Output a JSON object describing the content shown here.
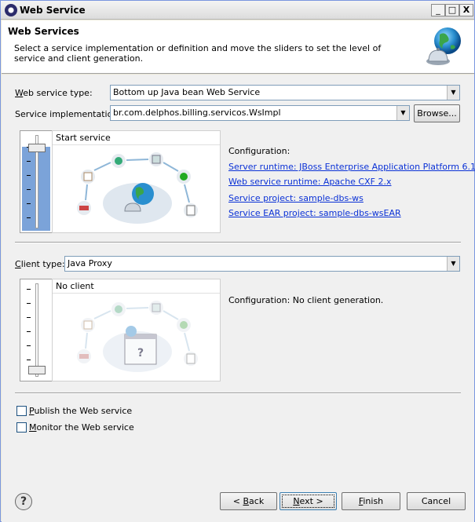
{
  "window": {
    "title": "Web Service",
    "minimize": "_",
    "maximize": "□",
    "close": "X"
  },
  "header": {
    "title": "Web Services",
    "description": "Select a service implementation or definition and move the sliders to set the level of service and client generation."
  },
  "service": {
    "type_label_pre": "",
    "type_label_u": "W",
    "type_label_post": "eb service type:",
    "type_value": "Bottom up Java bean Web Service",
    "impl_label": "Service implementation:",
    "impl_value": "br.com.delphos.billing.servicos.WsImpl",
    "browse": "Browse...",
    "slider_label": "Start service",
    "slider_level": 1,
    "config_heading": "Configuration:",
    "config_links": [
      "Server runtime: JBoss Enterprise Application Platform 6.1+",
      "Web service runtime: Apache CXF 2.x",
      "Service project: sample-dbs-ws",
      "Service EAR project: sample-dbs-wsEAR"
    ]
  },
  "client": {
    "type_label_u": "C",
    "type_label_post": "lient type:",
    "type_value": "Java Proxy",
    "slider_label": "No client",
    "slider_level": 6,
    "config_text": "Configuration: No client generation."
  },
  "options": {
    "publish_label_u": "P",
    "publish_label_post": "ublish the Web service",
    "publish_checked": false,
    "monitor_label_u": "M",
    "monitor_label_post": "onitor the Web service",
    "monitor_checked": false
  },
  "footer": {
    "help": "?",
    "back_pre": "< ",
    "back_u": "B",
    "back_post": "ack",
    "next_u": "N",
    "next_post": "ext >",
    "finish_u": "F",
    "finish_post": "inish",
    "cancel": "Cancel"
  }
}
